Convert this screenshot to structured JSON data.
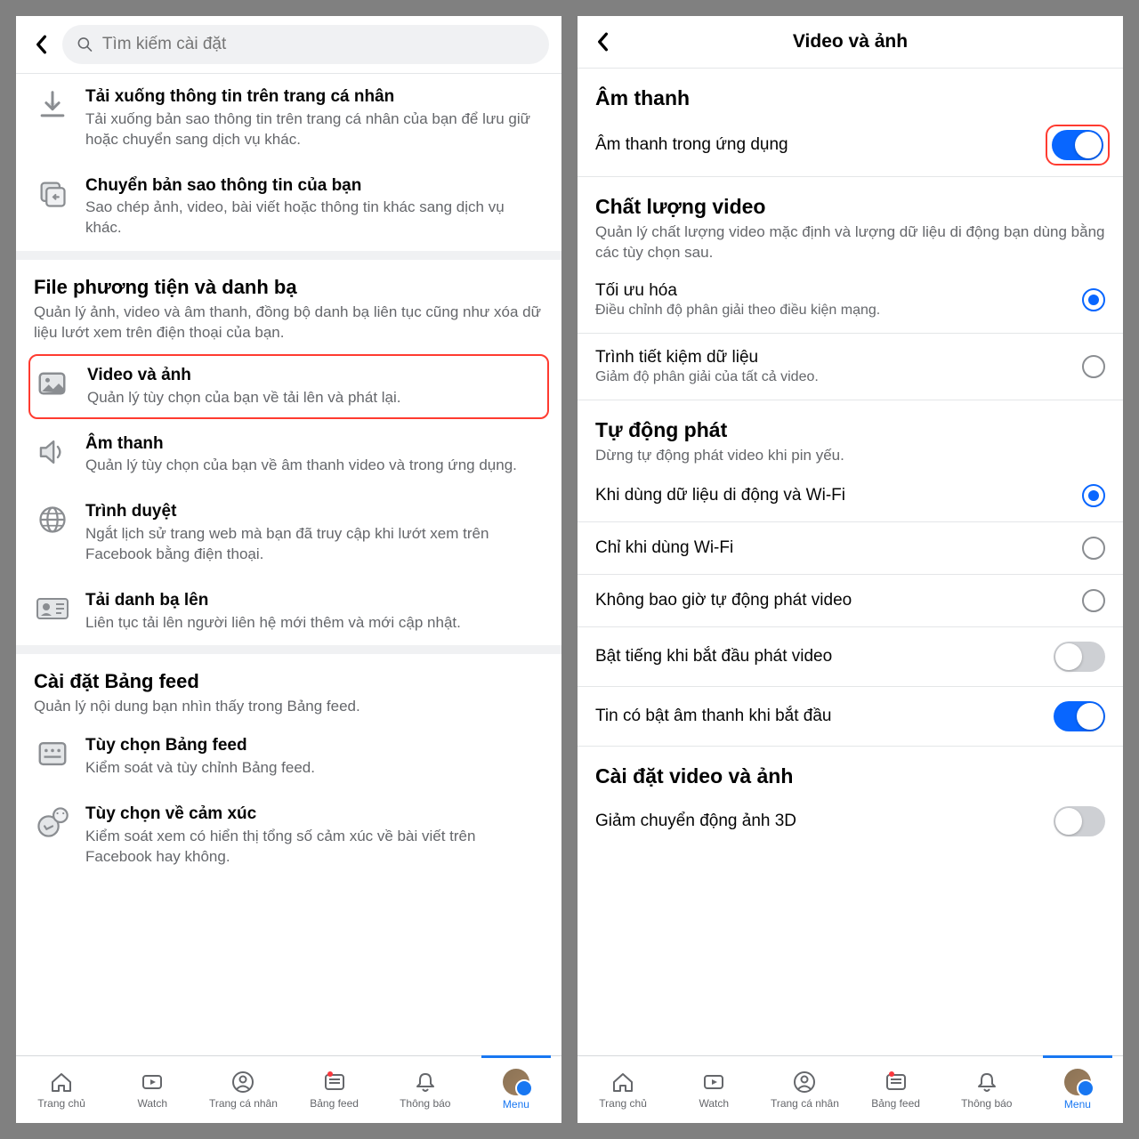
{
  "left": {
    "search_placeholder": "Tìm kiếm cài đặt",
    "download": {
      "title": "Tải xuống thông tin trên trang cá nhân",
      "sub": "Tải xuống bản sao thông tin trên trang cá nhân của bạn để lưu giữ hoặc chuyển sang dịch vụ khác."
    },
    "transfer": {
      "title": "Chuyển bản sao thông tin của bạn",
      "sub": "Sao chép ảnh, video, bài viết hoặc thông tin khác sang dịch vụ khác."
    },
    "media_section": {
      "title": "File phương tiện và danh bạ",
      "desc": "Quản lý ảnh, video và âm thanh, đồng bộ danh bạ liên tục cũng như xóa dữ liệu lướt xem trên điện thoại của bạn."
    },
    "video_photo": {
      "title": "Video và ảnh",
      "sub": "Quản lý tùy chọn của bạn về tải lên và phát lại."
    },
    "sound": {
      "title": "Âm thanh",
      "sub": "Quản lý tùy chọn của bạn về âm thanh video và trong ứng dụng."
    },
    "browser": {
      "title": "Trình duyệt",
      "sub": "Ngắt lịch sử trang web mà bạn đã truy cập khi lướt xem trên Facebook bằng điện thoại."
    },
    "contacts": {
      "title": "Tải danh bạ lên",
      "sub": "Liên tục tải lên người liên hệ mới thêm và mới cập nhật."
    },
    "feed_section": {
      "title": "Cài đặt Bảng feed",
      "desc": "Quản lý nội dung bạn nhìn thấy trong Bảng feed."
    },
    "feed_opt": {
      "title": "Tùy chọn Bảng feed",
      "sub": "Kiểm soát và tùy chỉnh Bảng feed."
    },
    "reaction": {
      "title": "Tùy chọn về cảm xúc",
      "sub": "Kiểm soát xem có hiển thị tổng số cảm xúc về bài viết trên Facebook hay không."
    }
  },
  "right": {
    "title": "Video và ảnh",
    "sound_section": "Âm thanh",
    "in_app_sound": "Âm thanh trong ứng dụng",
    "quality": {
      "title": "Chất lượng video",
      "desc": "Quản lý chất lượng video mặc định và lượng dữ liệu di động bạn dùng bằng các tùy chọn sau."
    },
    "optimize": {
      "title": "Tối ưu hóa",
      "sub": "Điều chỉnh độ phân giải theo điều kiện mạng."
    },
    "data_saver": {
      "title": "Trình tiết kiệm dữ liệu",
      "sub": "Giảm độ phân giải của tất cả video."
    },
    "autoplay": {
      "title": "Tự động phát",
      "desc": "Dừng tự động phát video khi pin yếu."
    },
    "ap_mobile_wifi": "Khi dùng dữ liệu di động và Wi-Fi",
    "ap_wifi": "Chỉ khi dùng Wi-Fi",
    "ap_never": "Không bao giờ tự động phát video",
    "sound_on_start": "Bật tiếng khi bắt đầu phát video",
    "stories_sound": "Tin có bật âm thanh khi bắt đầu",
    "vp_settings": "Cài đặt video và ảnh",
    "reduce_3d": "Giảm chuyển động ảnh 3D"
  },
  "tabs": {
    "home": "Trang chủ",
    "watch": "Watch",
    "profile": "Trang cá nhân",
    "feed": "Bảng feed",
    "notif": "Thông báo",
    "menu": "Menu"
  }
}
